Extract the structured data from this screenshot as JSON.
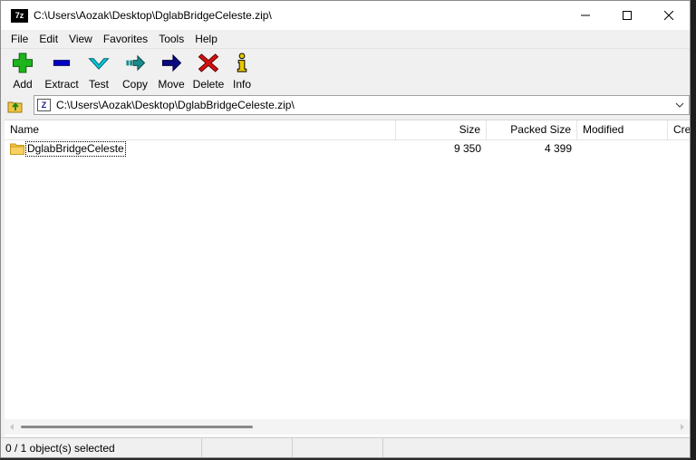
{
  "window": {
    "title": "C:\\Users\\Aozak\\Desktop\\DglabBridgeCeleste.zip\\",
    "app_icon_text": "7z"
  },
  "menu": [
    "File",
    "Edit",
    "View",
    "Favorites",
    "Tools",
    "Help"
  ],
  "toolbar": {
    "add": "Add",
    "extract": "Extract",
    "test": "Test",
    "copy": "Copy",
    "move": "Move",
    "delete": "Delete",
    "info": "Info"
  },
  "address": {
    "path": "C:\\Users\\Aozak\\Desktop\\DglabBridgeCeleste.zip\\"
  },
  "columns": {
    "name": "Name",
    "size": "Size",
    "packed": "Packed Size",
    "modified": "Modified",
    "created": "Cre"
  },
  "files": [
    {
      "name": "DglabBridgeCeleste",
      "size": "9 350",
      "packed": "4 399",
      "modified": ""
    }
  ],
  "status": {
    "selection": "0 / 1 object(s) selected"
  },
  "colors": {
    "add_green": "#1cb51c",
    "extract_blue": "#0000c8",
    "test_cyan": "#00b4c8",
    "copy_teal": "#1a8a8a",
    "move_navy": "#0a0a80",
    "delete_red": "#d41010",
    "info_yellow": "#e8c800",
    "folder_yellow": "#f3c343"
  }
}
